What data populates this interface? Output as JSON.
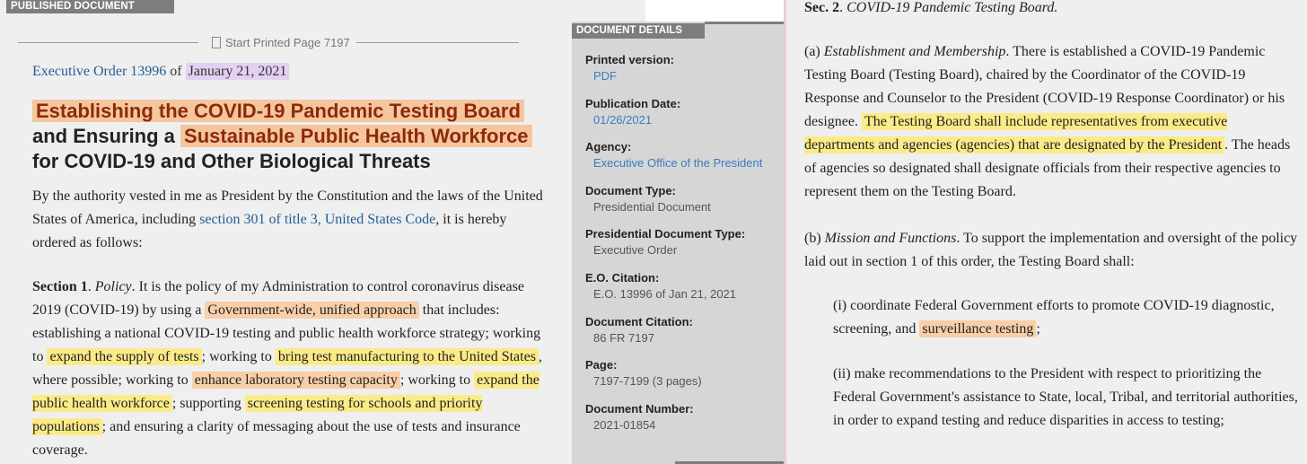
{
  "header": {
    "published_label": "PUBLISHED DOCUMENT"
  },
  "printed_page": "Start Printed Page 7197",
  "eo_line": {
    "link": "Executive Order 13996",
    "of": "of",
    "date": "January 21, 2021"
  },
  "title": {
    "part1": "Establishing the COVID-19 Pandemic Testing Board",
    "part2": "and Ensuring a",
    "part3": "Sustainable Public Health Workforce",
    "part4": "for COVID-19 and Other Biological Threats"
  },
  "intro": {
    "pre": "By the authority vested in me as President by the Constitution and the laws of the United States of America, including ",
    "link": "section 301 of title 3, United States Code",
    "post": ", it is hereby ordered as follows:"
  },
  "section1": {
    "heading": "Section 1",
    "sep": ". ",
    "policy": "Policy",
    "t1": ". It is the policy of my Administration to control coronavirus disease 2019 (COVID-19) by using a ",
    "h1": "Government-wide, unified approach",
    "t2": " that includes: establishing a national COVID-19 testing and public health workforce strategy; working to ",
    "h2": "expand the supply of tests",
    "t3": "; working to ",
    "h3": "bring test manufacturing to the United States",
    "t4": ", where possible; working to ",
    "h4": "enhance laboratory testing capacity",
    "t5": "; working to ",
    "h5": "expand the public health workforce",
    "t6": "; supporting ",
    "h6": "screening testing for schools and priority populations",
    "t7": "; and ensuring a clarity of messaging about the use of tests and insurance coverage."
  },
  "details": {
    "label": "DOCUMENT DETAILS",
    "items": [
      {
        "key": "Printed version:",
        "value": "PDF",
        "link": true
      },
      {
        "key": "Publication Date:",
        "value": "01/26/2021",
        "link": true
      },
      {
        "key": "Agency:",
        "value": "Executive Office of the President",
        "link": true
      },
      {
        "key": "Document Type:",
        "value": "Presidential Document",
        "link": false
      },
      {
        "key": "Presidential Document Type:",
        "value": "Executive Order",
        "link": false
      },
      {
        "key": "E.O. Citation:",
        "value": "E.O. 13996 of Jan 21, 2021",
        "link": false
      },
      {
        "key": "Document Citation:",
        "value": "86 FR 7197",
        "link": false
      },
      {
        "key": "Page:",
        "value": "7197-7199 (3 pages)",
        "link": false
      },
      {
        "key": "Document Number:",
        "value": "2021-01854",
        "link": false
      }
    ]
  },
  "section2": {
    "heading": "Sec. 2",
    "sep": ". ",
    "title": "COVID-19 Pandemic Testing Board.",
    "a_label": "(a) ",
    "a_italic": "Establishment and Membership",
    "a_t1": ". There is established a COVID-19 Pandemic Testing Board (Testing Board), chaired by the Coordinator of the COVID-19 Response and Counselor to the President (COVID-19 Response Coordinator) or his designee. ",
    "a_h1": "The Testing Board shall include representatives from executive departments and agencies (agencies) that are designated by the President",
    "a_t2": ". The heads of agencies so designated shall designate officials from their respective agencies to represent them on the Testing Board.",
    "b_label": "(b) ",
    "b_italic": "Mission and Functions",
    "b_t1": ". To support the implementation and oversight of the policy laid out in section 1 of this order, the Testing Board shall:",
    "i_t1": "(i) coordinate Federal Government efforts to promote COVID-19 diagnostic, screening, and ",
    "i_h1": "surveillance testing",
    "i_t2": ";",
    "ii_t1": "(ii) make recommendations to the President with respect to prioritizing the Federal Government's assistance to State, local, Tribal, and territorial authorities, in order to expand testing and reduce disparities in access to testing;"
  }
}
